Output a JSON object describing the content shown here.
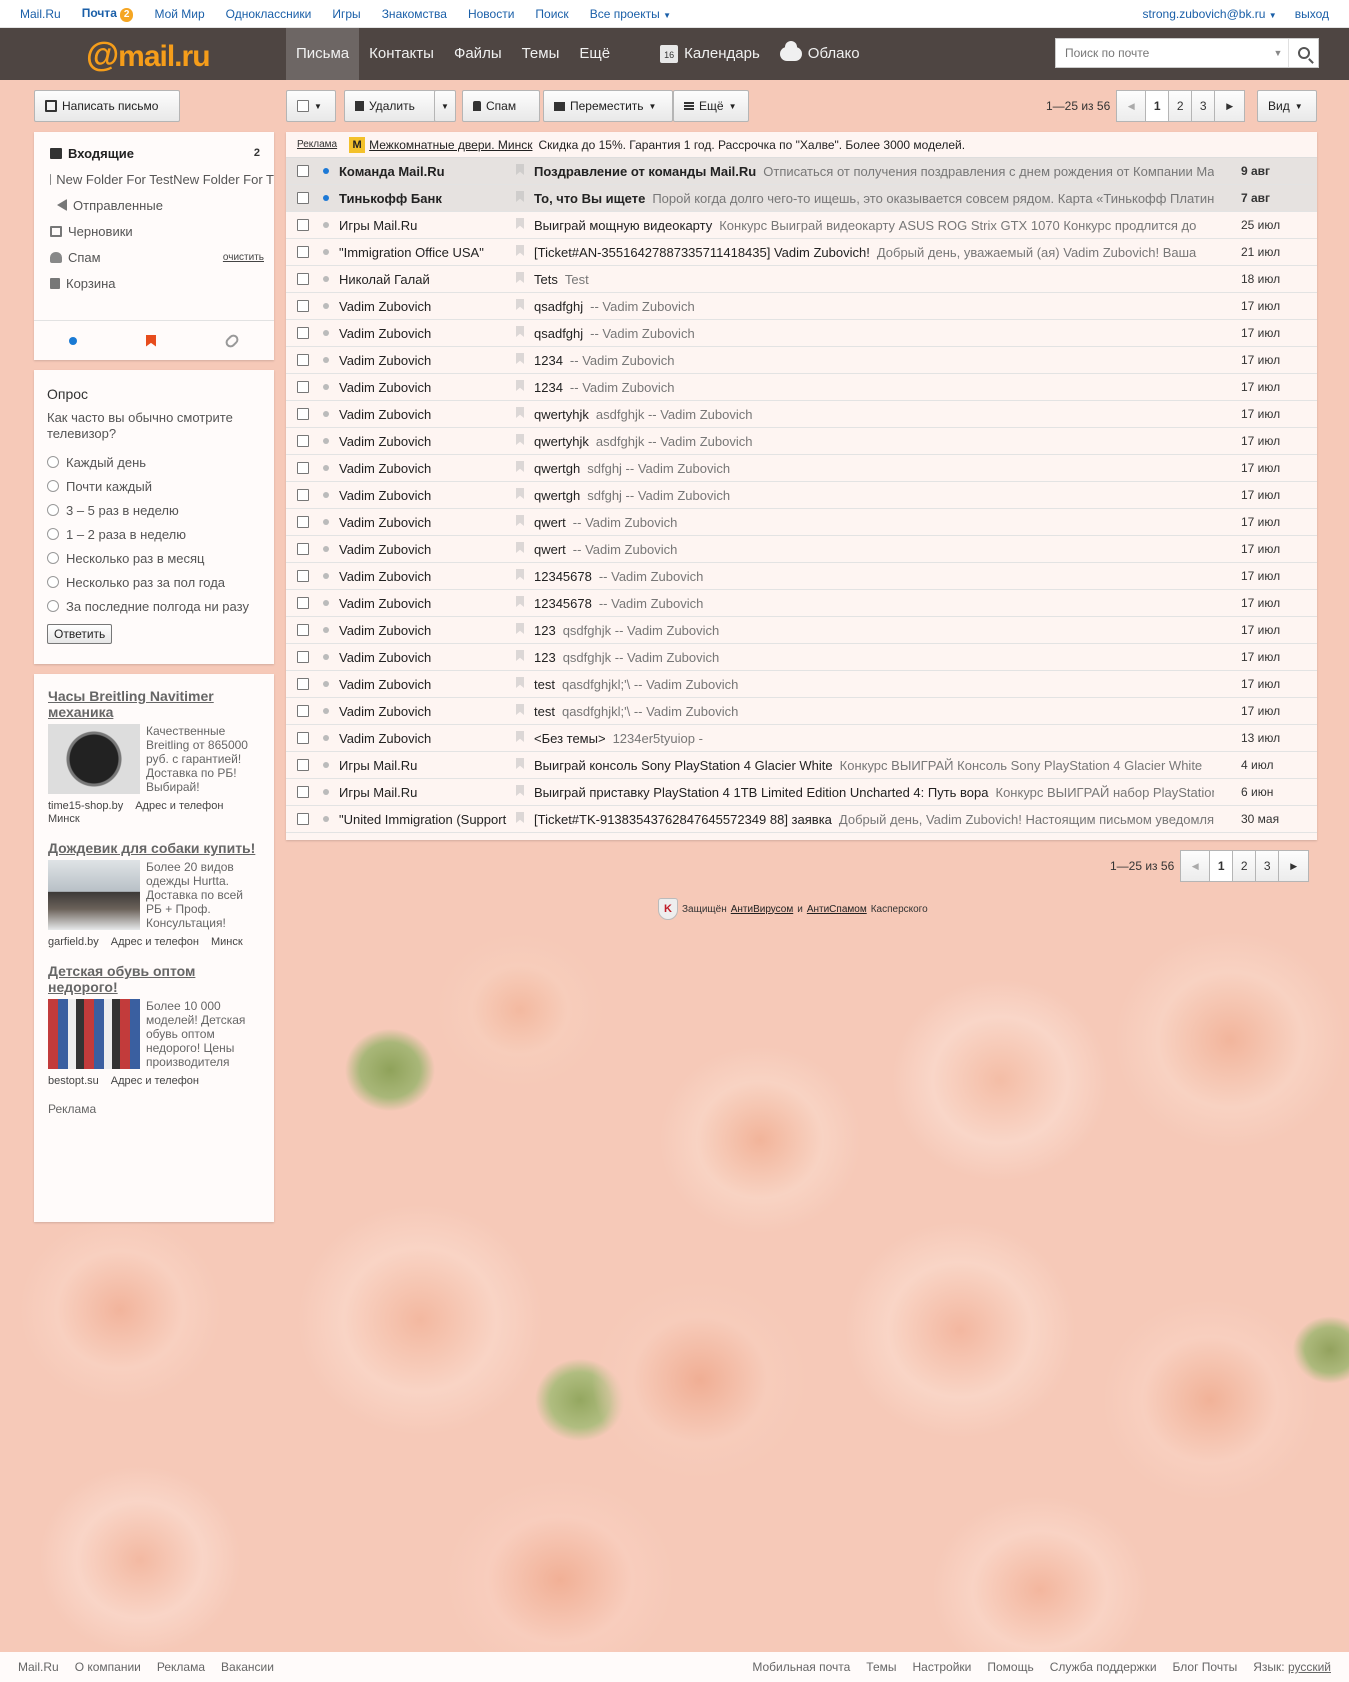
{
  "portal": {
    "links": [
      "Mail.Ru",
      "Почта",
      "Мой Мир",
      "Одноклассники",
      "Игры",
      "Знакомства",
      "Новости",
      "Поиск",
      "Все проекты"
    ],
    "mail_badge": "2",
    "user_email": "strong.zubovich@bk.ru",
    "logout": "выход"
  },
  "header": {
    "logo_at": "@",
    "logo_text": "mail.ru",
    "nav": [
      "Письма",
      "Контакты",
      "Файлы",
      "Темы",
      "Ещё"
    ],
    "calendar_label": "Календарь",
    "calendar_day": "16",
    "cloud_label": "Облако",
    "search_placeholder": "Поиск по почте"
  },
  "toolbar": {
    "compose": "Написать письмо",
    "delete": "Удалить",
    "spam": "Спам",
    "move": "Переместить",
    "more": "Ещё",
    "view": "Вид"
  },
  "pager": {
    "range": "1—25 из 56",
    "pages": [
      "1",
      "2",
      "3"
    ],
    "current": "1"
  },
  "folders": {
    "inbox": "Входящие",
    "inbox_count": "2",
    "custom": "New Folder For TestNew Folder For T",
    "sent": "Отправленные",
    "drafts": "Черновики",
    "spam": "Спам",
    "spam_clean": "очистить",
    "trash": "Корзина"
  },
  "poll": {
    "title": "Опрос",
    "question": "Как часто вы обычно смотрите телевизор?",
    "options": [
      "Каждый день",
      "Почти каждый",
      "3 – 5 раз в неделю",
      "1 – 2 раза в неделю",
      "Несколько раз в месяц",
      "Несколько раз за пол года",
      "За последние полгода ни разу"
    ],
    "answer_button": "Ответить"
  },
  "side_ads": {
    "items": [
      {
        "title": "Часы Breitling Navitimer механика",
        "text": "Качественные Breitling от 865000 руб. с гарантией! Доставка по РБ! Выбирай!",
        "domain": "time15-shop.by",
        "contacts": "Адрес и телефон",
        "city": "Минск"
      },
      {
        "title": "Дождевик для собаки купить!",
        "text": "Более 20 видов одежды Hurtta. Доставка по всей РБ + Проф. Консультация!",
        "domain": "garfield.by",
        "contacts": "Адрес и телефон",
        "city": "Минск"
      },
      {
        "title": "Детская обувь оптом недорого!",
        "text": "Более 10 000 моделей! Детская обувь оптом недорого! Цены производителя",
        "domain": "bestopt.su",
        "contacts": "Адрес и телефон",
        "city": ""
      }
    ],
    "label": "Реклама"
  },
  "list_ad": {
    "tag": "Реклама",
    "icon": "M",
    "link": "Межкомнатные двери. Минск",
    "text": "Скидка до 15%. Гарантия 1 год. Рассрочка по \"Халве\". Более 3000 моделей."
  },
  "letters": [
    {
      "from": "Команда Mail.Ru",
      "subject": "Поздравление от команды Mail.Ru",
      "snippet": "Отписаться от получения поздравления с днем рождения от Компании Mail.Ru",
      "date": "9 авг",
      "unread": true
    },
    {
      "from": "Тинькофф Банк",
      "subject": "То, что Вы ищете",
      "snippet": "Порой когда долго чего-то ищешь, это оказывается совсем рядом. Карта «Тинькофф Платинум»",
      "date": "7 авг",
      "unread": true
    },
    {
      "from": "Игры Mail.Ru",
      "subject": "Выиграй мощную видеокарту",
      "snippet": "Конкурс Выиграй видеокарту ASUS ROG Strix GTX 1070 Конкурс продлится до",
      "date": "25 июл",
      "unread": false
    },
    {
      "from": "\"Immigration Office USA\"",
      "subject": "[Ticket#AN-35516427887335711418435] Vadim Zubovich!",
      "snippet": "Добрый день, уважаемый (ая) Vadim Zubovich! Ваша",
      "date": "21 июл",
      "unread": false
    },
    {
      "from": "Николай Галай",
      "subject": "Tets",
      "snippet": "Test",
      "date": "18 июл",
      "unread": false
    },
    {
      "from": "Vadim Zubovich",
      "subject": "qsadfghj",
      "snippet": "-- Vadim Zubovich",
      "date": "17 июл",
      "unread": false
    },
    {
      "from": "Vadim Zubovich",
      "subject": "qsadfghj",
      "snippet": "-- Vadim Zubovich",
      "date": "17 июл",
      "unread": false
    },
    {
      "from": "Vadim Zubovich",
      "subject": "1234",
      "snippet": "-- Vadim Zubovich",
      "date": "17 июл",
      "unread": false
    },
    {
      "from": "Vadim Zubovich",
      "subject": "1234",
      "snippet": "-- Vadim Zubovich",
      "date": "17 июл",
      "unread": false
    },
    {
      "from": "Vadim Zubovich",
      "subject": "qwertyhjk",
      "snippet": "asdfghjk -- Vadim Zubovich",
      "date": "17 июл",
      "unread": false
    },
    {
      "from": "Vadim Zubovich",
      "subject": "qwertyhjk",
      "snippet": "asdfghjk -- Vadim Zubovich",
      "date": "17 июл",
      "unread": false
    },
    {
      "from": "Vadim Zubovich",
      "subject": "qwertgh",
      "snippet": "sdfghj -- Vadim Zubovich",
      "date": "17 июл",
      "unread": false
    },
    {
      "from": "Vadim Zubovich",
      "subject": "qwertgh",
      "snippet": "sdfghj -- Vadim Zubovich",
      "date": "17 июл",
      "unread": false
    },
    {
      "from": "Vadim Zubovich",
      "subject": "qwert",
      "snippet": "-- Vadim Zubovich",
      "date": "17 июл",
      "unread": false
    },
    {
      "from": "Vadim Zubovich",
      "subject": "qwert",
      "snippet": "-- Vadim Zubovich",
      "date": "17 июл",
      "unread": false
    },
    {
      "from": "Vadim Zubovich",
      "subject": "12345678",
      "snippet": "-- Vadim Zubovich",
      "date": "17 июл",
      "unread": false
    },
    {
      "from": "Vadim Zubovich",
      "subject": "12345678",
      "snippet": "-- Vadim Zubovich",
      "date": "17 июл",
      "unread": false
    },
    {
      "from": "Vadim Zubovich",
      "subject": "123",
      "snippet": "qsdfghjk -- Vadim Zubovich",
      "date": "17 июл",
      "unread": false
    },
    {
      "from": "Vadim Zubovich",
      "subject": "123",
      "snippet": "qsdfghjk -- Vadim Zubovich",
      "date": "17 июл",
      "unread": false
    },
    {
      "from": "Vadim Zubovich",
      "subject": "test",
      "snippet": "qasdfghjkl;'\\ -- Vadim Zubovich",
      "date": "17 июл",
      "unread": false
    },
    {
      "from": "Vadim Zubovich",
      "subject": "test",
      "snippet": "qasdfghjkl;'\\ -- Vadim Zubovich",
      "date": "17 июл",
      "unread": false
    },
    {
      "from": "Vadim Zubovich",
      "subject": "<Без темы>",
      "snippet": "1234er5tyuiop -",
      "date": "13 июл",
      "unread": false
    },
    {
      "from": "Игры Mail.Ru",
      "subject": "Выиграй консоль Sony PlayStation 4 Glacier White",
      "snippet": "Конкурс ВЫИГРАЙ Консоль Sony PlayStation 4 Glacier White",
      "date": "4 июл",
      "unread": false
    },
    {
      "from": "Игры Mail.Ru",
      "subject": "Выиграй приставку PlayStation 4 1TB Limited Edition Uncharted 4: Путь вора",
      "snippet": "Конкурс ВЫИГРАЙ набор PlayStation",
      "date": "6 июн",
      "unread": false
    },
    {
      "from": "\"United Immigration (Support",
      "subject": "[Ticket#TK-91383543762847645572349 88] заявка",
      "snippet": "Добрый день, Vadim Zubovich! Настоящим письмом уведомляем",
      "date": "30 мая",
      "unread": false
    }
  ],
  "kaspersky": {
    "prefix": "Защищён",
    "antivirus": "АнтиВирусом",
    "and": "и",
    "antispam": "АнтиСпамом",
    "suffix": "Касперского"
  },
  "footer": {
    "left": [
      "Mail.Ru",
      "О компании",
      "Реклама",
      "Вакансии"
    ],
    "right": [
      "Мобильная почта",
      "Темы",
      "Настройки",
      "Помощь",
      "Служба поддержки",
      "Блог Почты"
    ],
    "lang_label": "Язык:",
    "lang_value": "русский"
  },
  "colors": {
    "logo": "#f59d1a",
    "link": "#1a5fa8",
    "unread_dot": "#1d79d6",
    "badge": "#f5a623"
  }
}
